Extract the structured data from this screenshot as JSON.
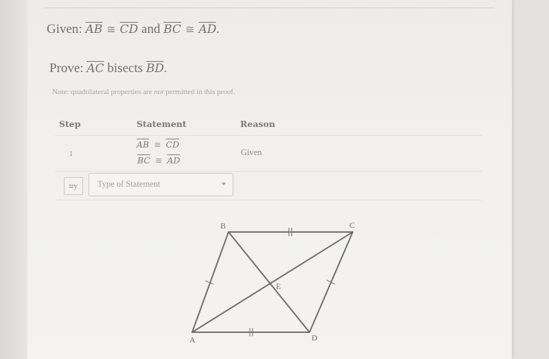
{
  "problem": {
    "given_prefix": "Given:",
    "given_seg1": "AB",
    "given_cong1": "≅",
    "given_seg2": "CD",
    "given_and": "and",
    "given_seg3": "BC",
    "given_cong2": "≅",
    "given_seg4": "AD",
    "given_end": ".",
    "prove_prefix": "Prove:",
    "prove_seg1": "AC",
    "prove_verb": "bisects",
    "prove_seg2": "BD",
    "prove_end": ".",
    "note_before": "Note: quadrilateral properties are",
    "note_em": "not",
    "note_after": "permitted in this proof."
  },
  "proof_table": {
    "headers": {
      "step": "Step",
      "statement": "Statement",
      "reason": "Reason"
    },
    "rows": [
      {
        "step": "1",
        "statement_lines": [
          {
            "left": "AB",
            "rel": "≅",
            "right": "CD"
          },
          {
            "left": "BC",
            "rel": "≅",
            "right": "AD"
          }
        ],
        "reason": "Given"
      }
    ],
    "new_row": {
      "try_label": "try",
      "statement_type_placeholder": "Type of Statement"
    }
  },
  "figure": {
    "points": {
      "A": "A",
      "B": "B",
      "C": "C",
      "D": "D",
      "E": "E"
    },
    "single_tick_sides": [
      "AB",
      "CD"
    ],
    "double_tick_sides": [
      "BC",
      "AD"
    ],
    "diagonals": [
      "AC",
      "BD"
    ],
    "intersection": "E"
  }
}
